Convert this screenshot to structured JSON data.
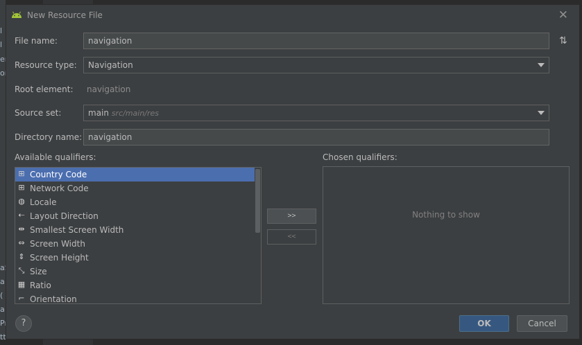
{
  "window": {
    "title": "New Resource File"
  },
  "background_fragments": [
    "l",
    "l",
    "er",
    "on",
    "aS",
    "a",
    "(",
    "a",
    "Pr",
    "ttg"
  ],
  "form": {
    "file_name_label": "File name:",
    "file_name_value": "navigation",
    "resource_type_label": "Resource type:",
    "resource_type_value": "Navigation",
    "root_element_label": "Root element:",
    "root_element_value": "navigation",
    "source_set_label": "Source set:",
    "source_set_value": "main",
    "source_set_path": "src/main/res",
    "directory_name_label": "Directory name:",
    "directory_name_value": "navigation"
  },
  "qualifiers": {
    "available_label": "Available qualifiers:",
    "chosen_label": "Chosen qualifiers:",
    "chosen_empty": "Nothing to show",
    "add_label": ">>",
    "remove_label": "<<",
    "items": [
      {
        "label": "Country Code",
        "icon": "country-code-icon",
        "glyph": "⊞",
        "selected": true
      },
      {
        "label": "Network Code",
        "icon": "network-code-icon",
        "glyph": "⊞",
        "selected": false
      },
      {
        "label": "Locale",
        "icon": "globe-icon",
        "glyph": "◍",
        "selected": false
      },
      {
        "label": "Layout Direction",
        "icon": "layout-direction-icon",
        "glyph": "⇠",
        "selected": false
      },
      {
        "label": "Smallest Screen Width",
        "icon": "smallest-width-icon",
        "glyph": "⇹",
        "selected": false
      },
      {
        "label": "Screen Width",
        "icon": "screen-width-icon",
        "glyph": "⇔",
        "selected": false
      },
      {
        "label": "Screen Height",
        "icon": "screen-height-icon",
        "glyph": "⇕",
        "selected": false
      },
      {
        "label": "Size",
        "icon": "size-icon",
        "glyph": "⤡",
        "selected": false
      },
      {
        "label": "Ratio",
        "icon": "ratio-icon",
        "glyph": "▦",
        "selected": false
      },
      {
        "label": "Orientation",
        "icon": "orientation-icon",
        "glyph": "⌐",
        "selected": false
      }
    ]
  },
  "buttons": {
    "help": "?",
    "ok": "OK",
    "cancel": "Cancel"
  },
  "colors": {
    "dialog_bg": "#3c3f41",
    "selection": "#4b6eaf",
    "primary_button": "#365880",
    "android_green": "#a4c639"
  }
}
